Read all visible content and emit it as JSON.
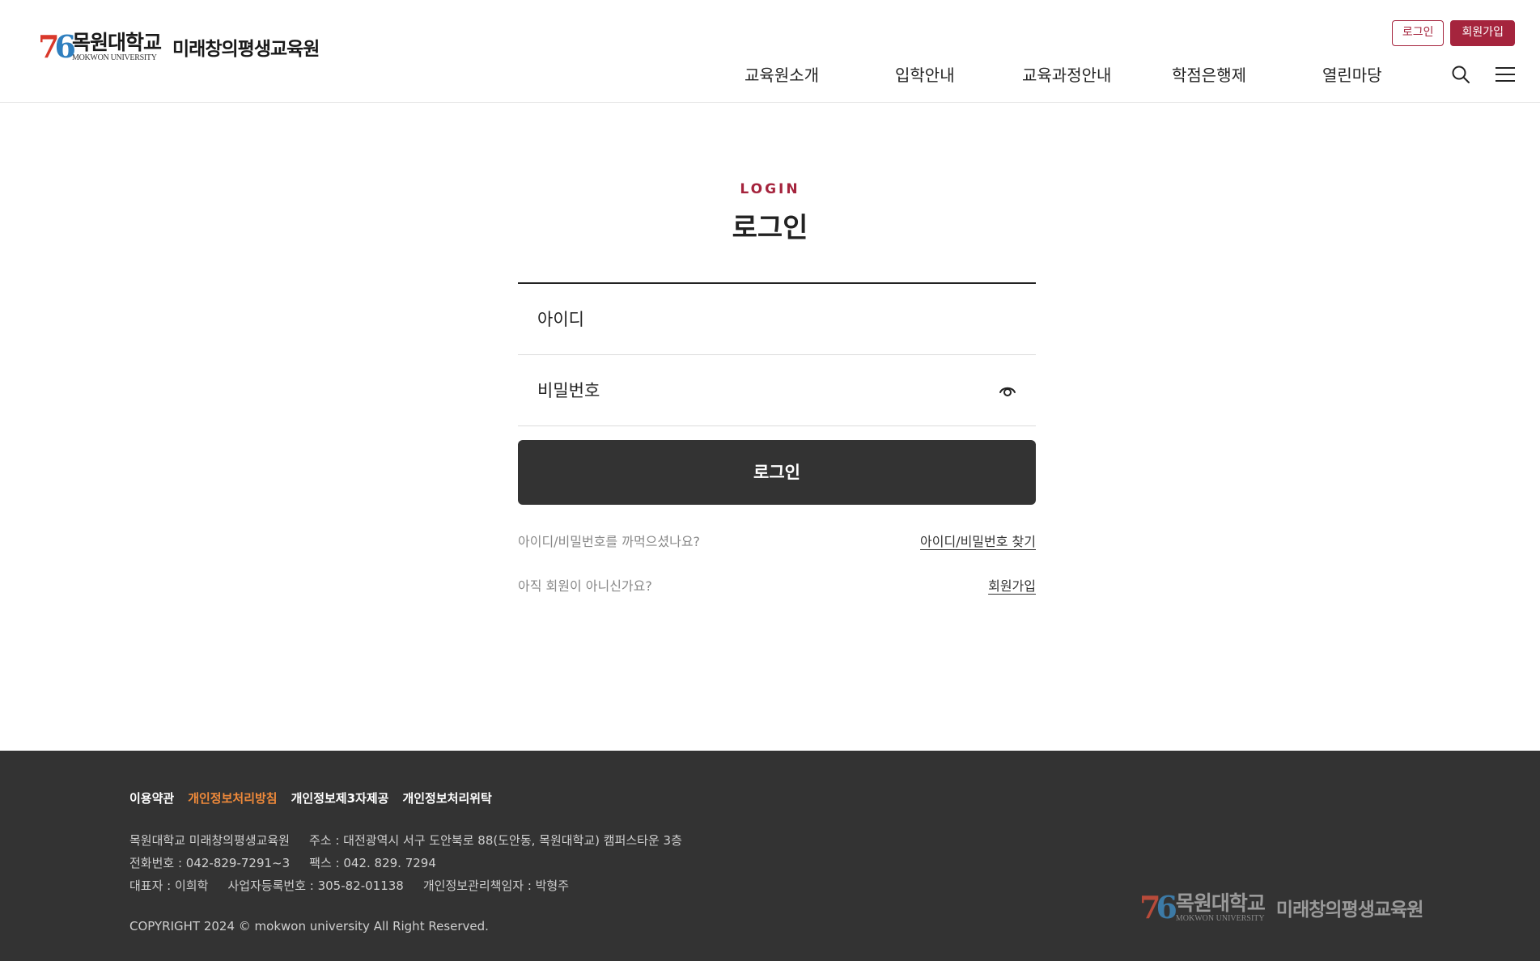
{
  "header": {
    "logo": {
      "mark": "76",
      "name_kr": "목원대학교",
      "name_en": "MOKWON UNIVERSITY",
      "subtitle": "미래창의평생교육원"
    },
    "login_btn": "로그인",
    "signup_btn": "회원가입",
    "nav": [
      "교육원소개",
      "입학안내",
      "교육과정안내",
      "학점은행제",
      "열린마당"
    ],
    "icons": {
      "search": "search-icon",
      "menu": "hamburger-menu-icon"
    }
  },
  "login": {
    "eyebrow": "LOGIN",
    "title": "로그인",
    "id_placeholder": "아이디",
    "pw_placeholder": "비밀번호",
    "submit": "로그인",
    "find_question": "아이디/비밀번호를 까먹으셨나요?",
    "find_link": "아이디/비밀번호 찾기",
    "signup_question": "아직 회원이 아니신가요?",
    "signup_link": "회원가입"
  },
  "footer": {
    "links": [
      "이용약관",
      "개인정보처리방침",
      "개인정보제3자제공",
      "개인정보처리위탁"
    ],
    "org": "목원대학교 미래창의평생교육원",
    "address": "주소 : 대전광역시 서구 도안북로 88(도안동, 목원대학교) 캠퍼스타운 3층",
    "phone": "전화번호 : 042-829-7291~3",
    "fax": "팩스 : 042. 829. 7294",
    "ceo": "대표자 : 이희학",
    "biz_no": "사업자등록번호 : 305-82-01138",
    "privacy_officer": "개인정보관리책임자 : 박형주",
    "copyright": "COPYRIGHT 2024 © mokwon university All Right Reserved.",
    "logo": {
      "mark": "76",
      "name_kr": "목원대학교",
      "name_en": "MOKWON UNIVERSITY",
      "subtitle": "미래창의평생교육원"
    }
  },
  "colors": {
    "accent": "#a5243d",
    "dark": "#333333",
    "footer_highlight": "#f08a3a"
  }
}
